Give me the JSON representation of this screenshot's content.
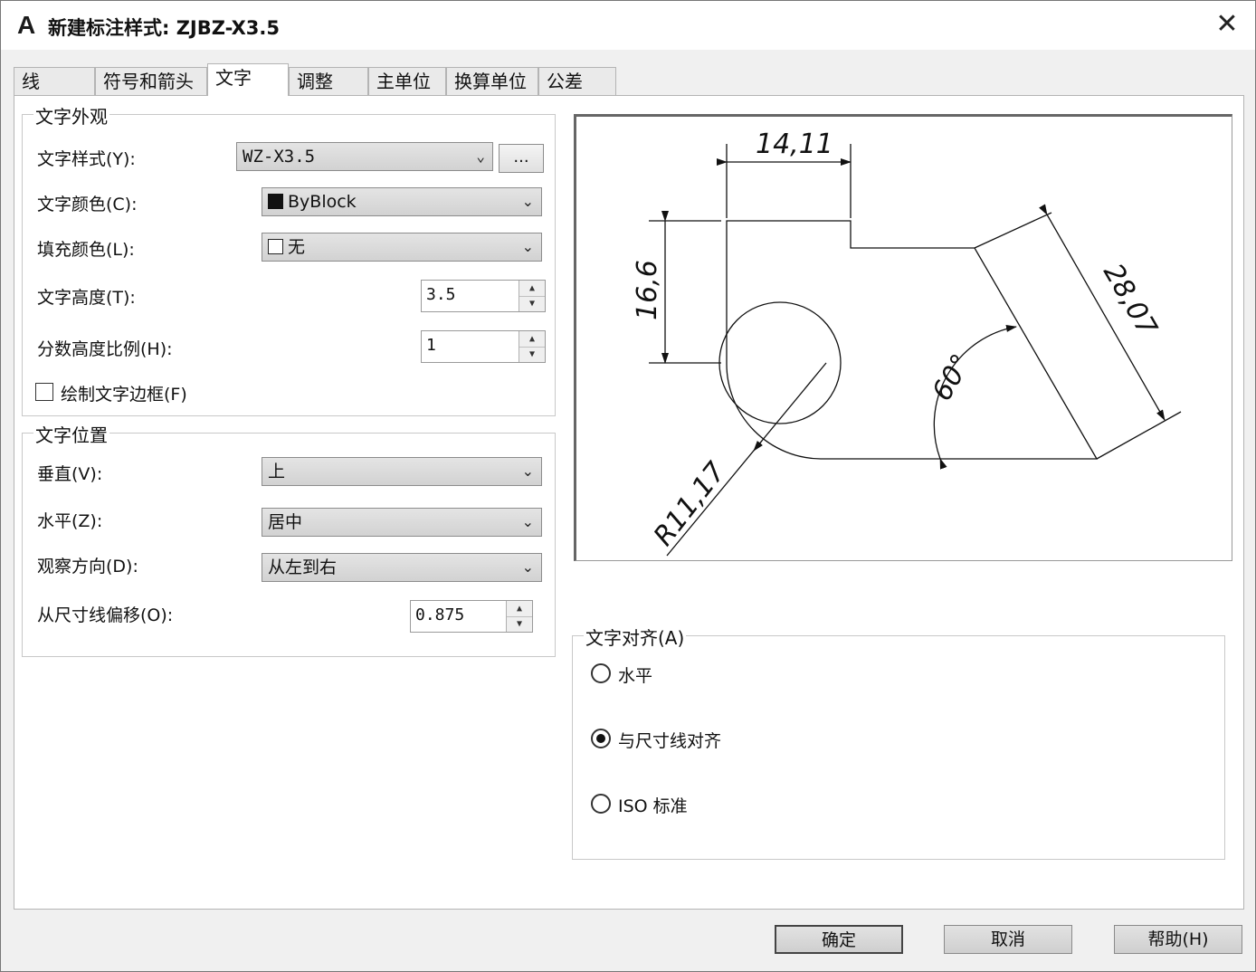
{
  "window": {
    "title": "新建标注样式: ZJBZ-X3.5",
    "close_glyph": "✕"
  },
  "tabs": [
    {
      "label": "线"
    },
    {
      "label": "符号和箭头"
    },
    {
      "label": "文字"
    },
    {
      "label": "调整"
    },
    {
      "label": "主单位"
    },
    {
      "label": "换算单位"
    },
    {
      "label": "公差"
    }
  ],
  "appearance": {
    "legend": "文字外观",
    "style_label": "文字样式(Y):",
    "style_value": "WZ-X3.5",
    "browse_label": "...",
    "color_label": "文字颜色(C):",
    "color_value": "ByBlock",
    "fill_label": "填充颜色(L):",
    "fill_value": "无",
    "height_label": "文字高度(T):",
    "height_value": "3.5",
    "fraction_label": "分数高度比例(H):",
    "fraction_value": "1",
    "frame_label": "绘制文字边框(F)",
    "frame_checked": false
  },
  "placement": {
    "legend": "文字位置",
    "vertical_label": "垂直(V):",
    "vertical_value": "上",
    "horizontal_label": "水平(Z):",
    "horizontal_value": "居中",
    "direction_label": "观察方向(D):",
    "direction_value": "从左到右",
    "offset_label": "从尺寸线偏移(O):",
    "offset_value": "0.875"
  },
  "preview": {
    "dim_top": "14,11",
    "dim_left": "16,6",
    "dim_right": "28,07",
    "angle": "60°",
    "radius": "R11,17"
  },
  "alignment": {
    "legend": "文字对齐(A)",
    "options": [
      {
        "label": "水平",
        "selected": false
      },
      {
        "label": "与尺寸线对齐",
        "selected": true
      },
      {
        "label": "ISO 标准",
        "selected": false
      }
    ]
  },
  "buttons": {
    "ok": "确定",
    "cancel": "取消",
    "help": "帮助(H)"
  },
  "colors": {
    "byblock_swatch": "#111111",
    "dialog_bg": "#f0f0f0"
  },
  "icons": {
    "app": "autocad-a-icon",
    "dropdown": "chevron-down-icon",
    "spin_up": "triangle-up-icon",
    "spin_down": "triangle-down-icon"
  }
}
